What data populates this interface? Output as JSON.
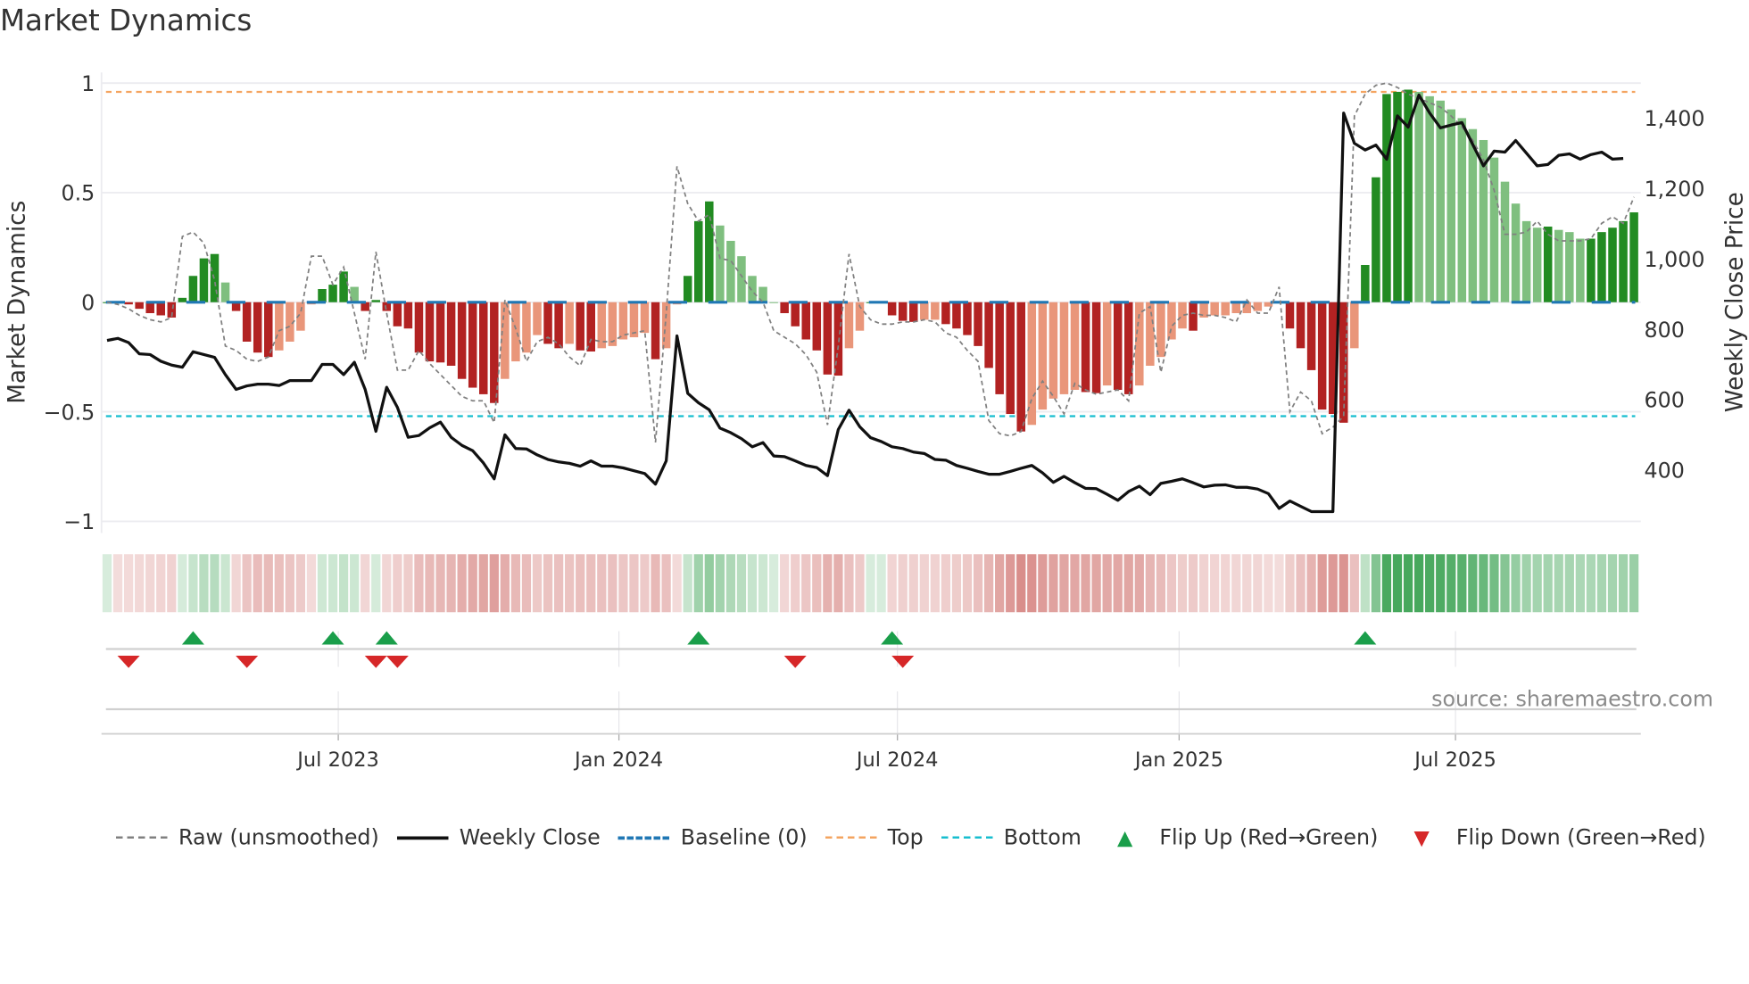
{
  "title": "Market Dynamics",
  "source": "source: sharemaestro.com",
  "colors": {
    "up_strong": "#228b22",
    "up_weak": "#7fbf7f",
    "down_strong": "#b22222",
    "down_weak": "#e9967a",
    "raw": "#808080",
    "close": "#111111",
    "baseline": "#1f77b4",
    "top": "#f4a460",
    "bottom": "#17becf",
    "flip_up": "#1a9e4a",
    "flip_down": "#d62728"
  },
  "chart_data": {
    "type": "bar",
    "title": "Market Dynamics",
    "ylabel": "Market Dynamics",
    "y2label": "Weekly Close Price",
    "ylim": [
      -1,
      1
    ],
    "y2lim": [
      240,
      1490
    ],
    "yticks": [
      {
        "v": 1,
        "label": "1"
      },
      {
        "v": 0.5,
        "label": "0.5"
      },
      {
        "v": 0,
        "label": "0"
      },
      {
        "v": -0.5,
        "label": "−0.5"
      },
      {
        "v": -1,
        "label": "−1"
      }
    ],
    "y2ticks": [
      {
        "v": 1400,
        "label": "1,400"
      },
      {
        "v": 1200,
        "label": "1,200"
      },
      {
        "v": 1000,
        "label": "1,000"
      },
      {
        "v": 800,
        "label": "800"
      },
      {
        "v": 600,
        "label": "600"
      },
      {
        "v": 400,
        "label": "400"
      }
    ],
    "xticks": [
      {
        "week": 21.5,
        "label": "Jul 2023"
      },
      {
        "week": 47.6,
        "label": "Jan 2024"
      },
      {
        "week": 73.5,
        "label": "Jul 2024"
      },
      {
        "week": 99.7,
        "label": "Jan 2025"
      },
      {
        "week": 125.4,
        "label": "Jul 2025"
      }
    ],
    "top_level": 0.96,
    "bottom_level": -0.52,
    "baseline": 0,
    "dynamics": [
      0,
      -0.005,
      -0.01,
      -0.03,
      -0.05,
      -0.06,
      -0.07,
      0.02,
      0.12,
      0.2,
      0.22,
      0.09,
      -0.04,
      -0.18,
      -0.23,
      -0.25,
      -0.22,
      -0.18,
      -0.13,
      -0.01,
      0.06,
      0.08,
      0.14,
      0.07,
      -0.04,
      0.01,
      -0.04,
      -0.11,
      -0.12,
      -0.23,
      -0.27,
      -0.275,
      -0.29,
      -0.35,
      -0.39,
      -0.42,
      -0.46,
      -0.35,
      -0.27,
      -0.23,
      -0.15,
      -0.19,
      -0.21,
      -0.19,
      -0.22,
      -0.225,
      -0.21,
      -0.2,
      -0.17,
      -0.16,
      -0.14,
      -0.26,
      -0.21,
      -0.01,
      0.12,
      0.37,
      0.46,
      0.35,
      0.28,
      0.21,
      0.12,
      0.07,
      0.0,
      -0.05,
      -0.11,
      -0.17,
      -0.22,
      -0.33,
      -0.335,
      -0.21,
      -0.13,
      0.0,
      0.005,
      -0.06,
      -0.085,
      -0.09,
      -0.08,
      -0.08,
      -0.1,
      -0.12,
      -0.15,
      -0.2,
      -0.3,
      -0.42,
      -0.51,
      -0.59,
      -0.56,
      -0.49,
      -0.44,
      -0.42,
      -0.4,
      -0.41,
      -0.415,
      -0.38,
      -0.4,
      -0.42,
      -0.38,
      -0.29,
      -0.25,
      -0.17,
      -0.12,
      -0.13,
      -0.07,
      -0.06,
      -0.06,
      -0.05,
      -0.05,
      -0.04,
      -0.02,
      -0.005,
      -0.12,
      -0.21,
      -0.31,
      -0.49,
      -0.51,
      -0.55,
      -0.21,
      0.17,
      0.57,
      0.95,
      0.96,
      0.97,
      0.96,
      0.94,
      0.92,
      0.88,
      0.84,
      0.79,
      0.74,
      0.66,
      0.55,
      0.45,
      0.37,
      0.34,
      0.345,
      0.33,
      0.32,
      0.29,
      0.29,
      0.32,
      0.34,
      0.37,
      0.41
    ],
    "raw": [
      0,
      -0.01,
      -0.03,
      -0.06,
      -0.08,
      -0.09,
      -0.07,
      0.3,
      0.32,
      0.27,
      0.1,
      -0.2,
      -0.22,
      -0.26,
      -0.27,
      -0.25,
      -0.13,
      -0.11,
      -0.05,
      0.21,
      0.21,
      0.08,
      0.16,
      -0.05,
      -0.26,
      0.23,
      -0.05,
      -0.31,
      -0.31,
      -0.22,
      -0.28,
      -0.33,
      -0.38,
      -0.43,
      -0.45,
      -0.45,
      -0.55,
      0.01,
      -0.12,
      -0.27,
      -0.18,
      -0.16,
      -0.19,
      -0.25,
      -0.29,
      -0.17,
      -0.18,
      -0.18,
      -0.15,
      -0.14,
      -0.13,
      -0.64,
      -0.05,
      0.62,
      0.45,
      0.37,
      0.4,
      0.2,
      0.19,
      0.12,
      0.05,
      0.0,
      -0.13,
      -0.16,
      -0.19,
      -0.24,
      -0.32,
      -0.56,
      -0.2,
      0.22,
      -0.02,
      -0.08,
      -0.1,
      -0.1,
      -0.09,
      -0.09,
      -0.08,
      -0.09,
      -0.14,
      -0.16,
      -0.22,
      -0.27,
      -0.54,
      -0.6,
      -0.61,
      -0.59,
      -0.44,
      -0.36,
      -0.43,
      -0.51,
      -0.37,
      -0.4,
      -0.42,
      -0.41,
      -0.4,
      -0.45,
      -0.05,
      -0.02,
      -0.32,
      -0.11,
      -0.06,
      -0.05,
      -0.06,
      -0.06,
      -0.07,
      -0.09,
      0.01,
      -0.05,
      -0.05,
      0.07,
      -0.5,
      -0.41,
      -0.45,
      -0.6,
      -0.57,
      -0.52,
      0.85,
      0.95,
      0.99,
      1.0,
      0.98,
      0.95,
      0.93,
      0.91,
      0.89,
      0.85,
      0.8,
      0.74,
      0.65,
      0.51,
      0.31,
      0.31,
      0.32,
      0.37,
      0.31,
      0.28,
      0.28,
      0.28,
      0.29,
      0.36,
      0.39,
      0.36,
      0.48
    ],
    "close": [
      768,
      774,
      762,
      730,
      728,
      709,
      698,
      692,
      736,
      728,
      720,
      671,
      629,
      639,
      644,
      644,
      640,
      654,
      654,
      654,
      700,
      700,
      671,
      706,
      629,
      510,
      635,
      578,
      493,
      498,
      520,
      536,
      493,
      470,
      455,
      420,
      375,
      500,
      461,
      460,
      443,
      430,
      423,
      419,
      411,
      426,
      411,
      411,
      406,
      398,
      390,
      360,
      426,
      781,
      618,
      591,
      571,
      519,
      506,
      489,
      466,
      478,
      440,
      438,
      426,
      413,
      407,
      384,
      515,
      570,
      523,
      492,
      481,
      466,
      461,
      451,
      447,
      430,
      428,
      413,
      405,
      396,
      388,
      388,
      396,
      405,
      413,
      392,
      365,
      382,
      364,
      348,
      347,
      331,
      314,
      339,
      354,
      330,
      362,
      368,
      375,
      364,
      352,
      357,
      358,
      351,
      351,
      346,
      333,
      291,
      312,
      297,
      282,
      282,
      282,
      1414,
      1328,
      1309,
      1323,
      1283,
      1406,
      1374,
      1465,
      1414,
      1372,
      1380,
      1387,
      1325,
      1264,
      1306,
      1303,
      1336,
      1300,
      1264,
      1268,
      1294,
      1298,
      1283,
      1296,
      1303,
      1283,
      1285
    ],
    "flip_up_weeks": [
      8,
      21,
      26,
      55,
      73,
      117
    ],
    "flip_down_weeks": [
      2,
      13,
      25,
      27,
      64,
      74
    ],
    "legend": [
      {
        "key": "raw",
        "label": "Raw (unsmoothed)"
      },
      {
        "key": "close",
        "label": "Weekly Close"
      },
      {
        "key": "baseline",
        "label": "Baseline (0)"
      },
      {
        "key": "top",
        "label": "Top"
      },
      {
        "key": "bottom",
        "label": "Bottom"
      },
      {
        "key": "flip_up",
        "label": "Flip Up (Red→Green)"
      },
      {
        "key": "flip_down",
        "label": "Flip Down (Green→Red)"
      }
    ],
    "legend_position": "bottom"
  }
}
